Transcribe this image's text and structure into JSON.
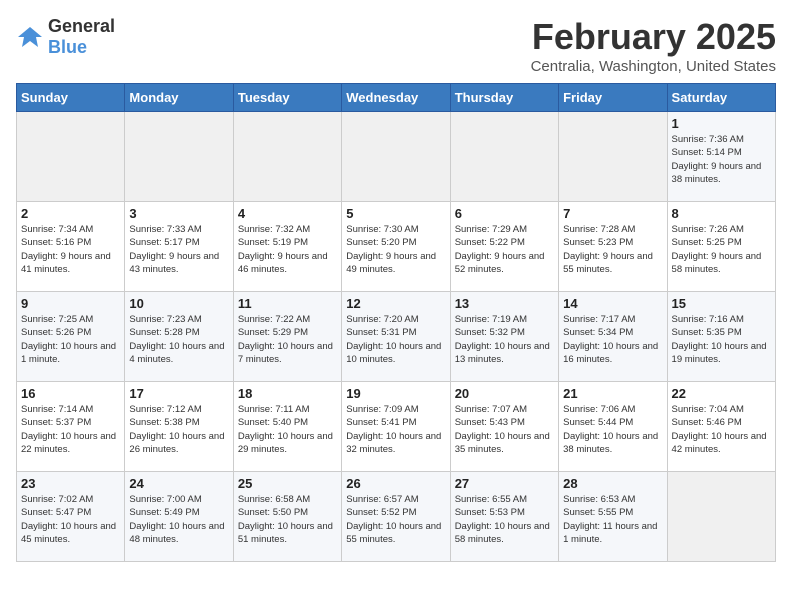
{
  "header": {
    "logo_general": "General",
    "logo_blue": "Blue",
    "title": "February 2025",
    "subtitle": "Centralia, Washington, United States"
  },
  "days_of_week": [
    "Sunday",
    "Monday",
    "Tuesday",
    "Wednesday",
    "Thursday",
    "Friday",
    "Saturday"
  ],
  "weeks": [
    [
      {
        "day": "",
        "info": ""
      },
      {
        "day": "",
        "info": ""
      },
      {
        "day": "",
        "info": ""
      },
      {
        "day": "",
        "info": ""
      },
      {
        "day": "",
        "info": ""
      },
      {
        "day": "",
        "info": ""
      },
      {
        "day": "1",
        "info": "Sunrise: 7:36 AM\nSunset: 5:14 PM\nDaylight: 9 hours and 38 minutes."
      }
    ],
    [
      {
        "day": "2",
        "info": "Sunrise: 7:34 AM\nSunset: 5:16 PM\nDaylight: 9 hours and 41 minutes."
      },
      {
        "day": "3",
        "info": "Sunrise: 7:33 AM\nSunset: 5:17 PM\nDaylight: 9 hours and 43 minutes."
      },
      {
        "day": "4",
        "info": "Sunrise: 7:32 AM\nSunset: 5:19 PM\nDaylight: 9 hours and 46 minutes."
      },
      {
        "day": "5",
        "info": "Sunrise: 7:30 AM\nSunset: 5:20 PM\nDaylight: 9 hours and 49 minutes."
      },
      {
        "day": "6",
        "info": "Sunrise: 7:29 AM\nSunset: 5:22 PM\nDaylight: 9 hours and 52 minutes."
      },
      {
        "day": "7",
        "info": "Sunrise: 7:28 AM\nSunset: 5:23 PM\nDaylight: 9 hours and 55 minutes."
      },
      {
        "day": "8",
        "info": "Sunrise: 7:26 AM\nSunset: 5:25 PM\nDaylight: 9 hours and 58 minutes."
      }
    ],
    [
      {
        "day": "9",
        "info": "Sunrise: 7:25 AM\nSunset: 5:26 PM\nDaylight: 10 hours and 1 minute."
      },
      {
        "day": "10",
        "info": "Sunrise: 7:23 AM\nSunset: 5:28 PM\nDaylight: 10 hours and 4 minutes."
      },
      {
        "day": "11",
        "info": "Sunrise: 7:22 AM\nSunset: 5:29 PM\nDaylight: 10 hours and 7 minutes."
      },
      {
        "day": "12",
        "info": "Sunrise: 7:20 AM\nSunset: 5:31 PM\nDaylight: 10 hours and 10 minutes."
      },
      {
        "day": "13",
        "info": "Sunrise: 7:19 AM\nSunset: 5:32 PM\nDaylight: 10 hours and 13 minutes."
      },
      {
        "day": "14",
        "info": "Sunrise: 7:17 AM\nSunset: 5:34 PM\nDaylight: 10 hours and 16 minutes."
      },
      {
        "day": "15",
        "info": "Sunrise: 7:16 AM\nSunset: 5:35 PM\nDaylight: 10 hours and 19 minutes."
      }
    ],
    [
      {
        "day": "16",
        "info": "Sunrise: 7:14 AM\nSunset: 5:37 PM\nDaylight: 10 hours and 22 minutes."
      },
      {
        "day": "17",
        "info": "Sunrise: 7:12 AM\nSunset: 5:38 PM\nDaylight: 10 hours and 26 minutes."
      },
      {
        "day": "18",
        "info": "Sunrise: 7:11 AM\nSunset: 5:40 PM\nDaylight: 10 hours and 29 minutes."
      },
      {
        "day": "19",
        "info": "Sunrise: 7:09 AM\nSunset: 5:41 PM\nDaylight: 10 hours and 32 minutes."
      },
      {
        "day": "20",
        "info": "Sunrise: 7:07 AM\nSunset: 5:43 PM\nDaylight: 10 hours and 35 minutes."
      },
      {
        "day": "21",
        "info": "Sunrise: 7:06 AM\nSunset: 5:44 PM\nDaylight: 10 hours and 38 minutes."
      },
      {
        "day": "22",
        "info": "Sunrise: 7:04 AM\nSunset: 5:46 PM\nDaylight: 10 hours and 42 minutes."
      }
    ],
    [
      {
        "day": "23",
        "info": "Sunrise: 7:02 AM\nSunset: 5:47 PM\nDaylight: 10 hours and 45 minutes."
      },
      {
        "day": "24",
        "info": "Sunrise: 7:00 AM\nSunset: 5:49 PM\nDaylight: 10 hours and 48 minutes."
      },
      {
        "day": "25",
        "info": "Sunrise: 6:58 AM\nSunset: 5:50 PM\nDaylight: 10 hours and 51 minutes."
      },
      {
        "day": "26",
        "info": "Sunrise: 6:57 AM\nSunset: 5:52 PM\nDaylight: 10 hours and 55 minutes."
      },
      {
        "day": "27",
        "info": "Sunrise: 6:55 AM\nSunset: 5:53 PM\nDaylight: 10 hours and 58 minutes."
      },
      {
        "day": "28",
        "info": "Sunrise: 6:53 AM\nSunset: 5:55 PM\nDaylight: 11 hours and 1 minute."
      },
      {
        "day": "",
        "info": ""
      }
    ]
  ]
}
